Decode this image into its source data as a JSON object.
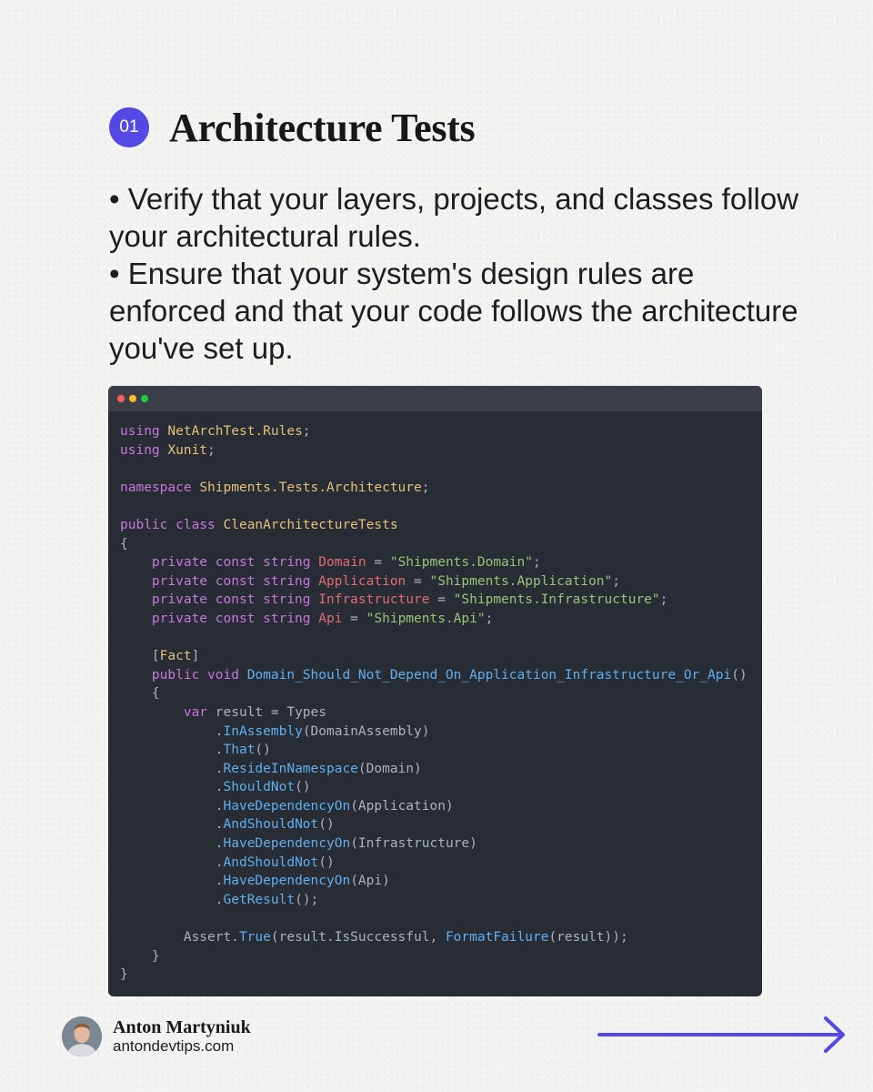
{
  "header": {
    "step_number": "01",
    "title": "Architecture Tests"
  },
  "bullets": [
    "• Verify that your layers, projects, and classes follow your architectural rules.",
    "• Ensure that your system's design rules are enforced and that your code follows the architecture you've set up."
  ],
  "code_window": {
    "traffic_lights": [
      "#ff5f57",
      "#febc2e",
      "#28c840"
    ],
    "lines": [
      [
        [
          "kw",
          "using "
        ],
        [
          "type",
          "NetArchTest.Rules"
        ],
        [
          "punct",
          ";"
        ]
      ],
      [
        [
          "kw",
          "using "
        ],
        [
          "type",
          "Xunit"
        ],
        [
          "punct",
          ";"
        ]
      ],
      [],
      [
        [
          "kw",
          "namespace "
        ],
        [
          "type",
          "Shipments.Tests.Architecture"
        ],
        [
          "punct",
          ";"
        ]
      ],
      [],
      [
        [
          "kw",
          "public class "
        ],
        [
          "type",
          "CleanArchitectureTests"
        ]
      ],
      [
        [
          "punct",
          "{"
        ]
      ],
      [
        [
          "punct",
          "    "
        ],
        [
          "kw",
          "private const string "
        ],
        [
          "const",
          "Domain"
        ],
        [
          "punct",
          " = "
        ],
        [
          "str",
          "\"Shipments.Domain\""
        ],
        [
          "punct",
          ";"
        ]
      ],
      [
        [
          "punct",
          "    "
        ],
        [
          "kw",
          "private const string "
        ],
        [
          "const",
          "Application"
        ],
        [
          "punct",
          " = "
        ],
        [
          "str",
          "\"Shipments.Application\""
        ],
        [
          "punct",
          ";"
        ]
      ],
      [
        [
          "punct",
          "    "
        ],
        [
          "kw",
          "private const string "
        ],
        [
          "const",
          "Infrastructure"
        ],
        [
          "punct",
          " = "
        ],
        [
          "str",
          "\"Shipments.Infrastructure\""
        ],
        [
          "punct",
          ";"
        ]
      ],
      [
        [
          "punct",
          "    "
        ],
        [
          "kw",
          "private const string "
        ],
        [
          "const",
          "Api"
        ],
        [
          "punct",
          " = "
        ],
        [
          "str",
          "\"Shipments.Api\""
        ],
        [
          "punct",
          ";"
        ]
      ],
      [],
      [
        [
          "punct",
          "    ["
        ],
        [
          "type",
          "Fact"
        ],
        [
          "punct",
          "]"
        ]
      ],
      [
        [
          "punct",
          "    "
        ],
        [
          "kw",
          "public void "
        ],
        [
          "fn",
          "Domain_Should_Not_Depend_On_Application_Infrastructure_Or_Api"
        ],
        [
          "punct",
          "()"
        ]
      ],
      [
        [
          "punct",
          "    {"
        ]
      ],
      [
        [
          "punct",
          "        "
        ],
        [
          "kw",
          "var "
        ],
        [
          "punct",
          "result = Types"
        ]
      ],
      [
        [
          "punct",
          "            ."
        ],
        [
          "fn",
          "InAssembly"
        ],
        [
          "punct",
          "(DomainAssembly)"
        ]
      ],
      [
        [
          "punct",
          "            ."
        ],
        [
          "fn",
          "That"
        ],
        [
          "punct",
          "()"
        ]
      ],
      [
        [
          "punct",
          "            ."
        ],
        [
          "fn",
          "ResideInNamespace"
        ],
        [
          "punct",
          "(Domain)"
        ]
      ],
      [
        [
          "punct",
          "            ."
        ],
        [
          "fn",
          "ShouldNot"
        ],
        [
          "punct",
          "()"
        ]
      ],
      [
        [
          "punct",
          "            ."
        ],
        [
          "fn",
          "HaveDependencyOn"
        ],
        [
          "punct",
          "(Application)"
        ]
      ],
      [
        [
          "punct",
          "            ."
        ],
        [
          "fn",
          "AndShouldNot"
        ],
        [
          "punct",
          "()"
        ]
      ],
      [
        [
          "punct",
          "            ."
        ],
        [
          "fn",
          "HaveDependencyOn"
        ],
        [
          "punct",
          "(Infrastructure)"
        ]
      ],
      [
        [
          "punct",
          "            ."
        ],
        [
          "fn",
          "AndShouldNot"
        ],
        [
          "punct",
          "()"
        ]
      ],
      [
        [
          "punct",
          "            ."
        ],
        [
          "fn",
          "HaveDependencyOn"
        ],
        [
          "punct",
          "(Api)"
        ]
      ],
      [
        [
          "punct",
          "            ."
        ],
        [
          "fn",
          "GetResult"
        ],
        [
          "punct",
          "();"
        ]
      ],
      [],
      [
        [
          "punct",
          "        Assert."
        ],
        [
          "fn",
          "True"
        ],
        [
          "punct",
          "(result.IsSuccessful, "
        ],
        [
          "fn",
          "FormatFailure"
        ],
        [
          "punct",
          "(result));"
        ]
      ],
      [
        [
          "punct",
          "    }"
        ]
      ],
      [
        [
          "punct",
          "}"
        ]
      ]
    ]
  },
  "footer": {
    "author_name": "Anton Martyniuk",
    "author_site": "antondevtips.com",
    "next_icon": "arrow-right-icon",
    "accent_color": "#5448e6"
  }
}
